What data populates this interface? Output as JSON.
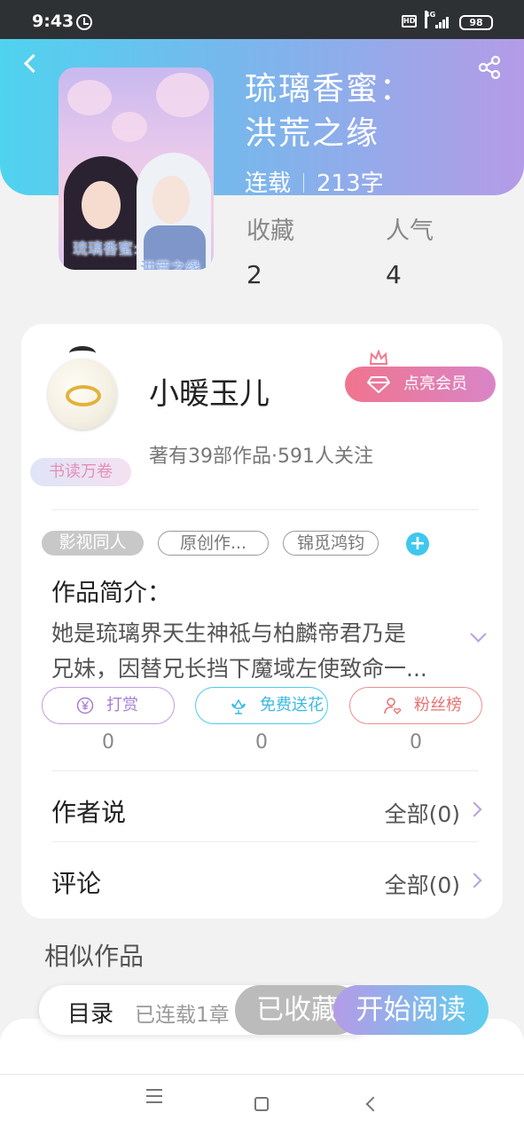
{
  "status_bar": {
    "time": "9:43",
    "network": "4G",
    "hd": "HD",
    "battery": "98"
  },
  "book": {
    "title_line1": "琉璃香蜜：",
    "title_line2": "洪荒之缘",
    "status": "连载",
    "word_count": "213字",
    "cover_caption_left": "琉璃香蜜",
    "cover_caption_right": "洪荒之缘"
  },
  "stats": {
    "favorites_label": "收藏",
    "favorites_value": "2",
    "popularity_label": "人气",
    "popularity_value": "4"
  },
  "author": {
    "name": "小暖玉儿",
    "works_summary": "著有39部作品·591人关注",
    "badge": "书读万卷",
    "vip_button": "点亮会员"
  },
  "tags": [
    "影视同人",
    "原创作...",
    "锦觅鸿钧"
  ],
  "intro": {
    "heading": "作品简介：",
    "line1": "她是琉璃界天生神祗与柏麟帝君乃是",
    "line2": "兄妹，因替兄长挡下魔域左使致命一..."
  },
  "actions": [
    {
      "label": "打赏",
      "icon": "yen-circle-icon",
      "count": "0"
    },
    {
      "label": "免费送花",
      "icon": "flower-icon",
      "count": "0"
    },
    {
      "label": "粉丝榜",
      "icon": "user-heart-icon",
      "count": "0"
    }
  ],
  "rows": {
    "author_says_label": "作者说",
    "author_says_value": "全部(0)",
    "comments_label": "评论",
    "comments_value": "全部(0)"
  },
  "similar_heading": "相似作品",
  "bottom_bar": {
    "toc_label": "目录",
    "toc_status": "已连载1章",
    "collected_label": "已收藏",
    "read_label": "开始阅读"
  },
  "colors": {
    "header_start": "#4fd3ef",
    "header_end": "#b59be7",
    "vip_start": "#f0748d",
    "accent_purple": "#b6a0e0"
  }
}
